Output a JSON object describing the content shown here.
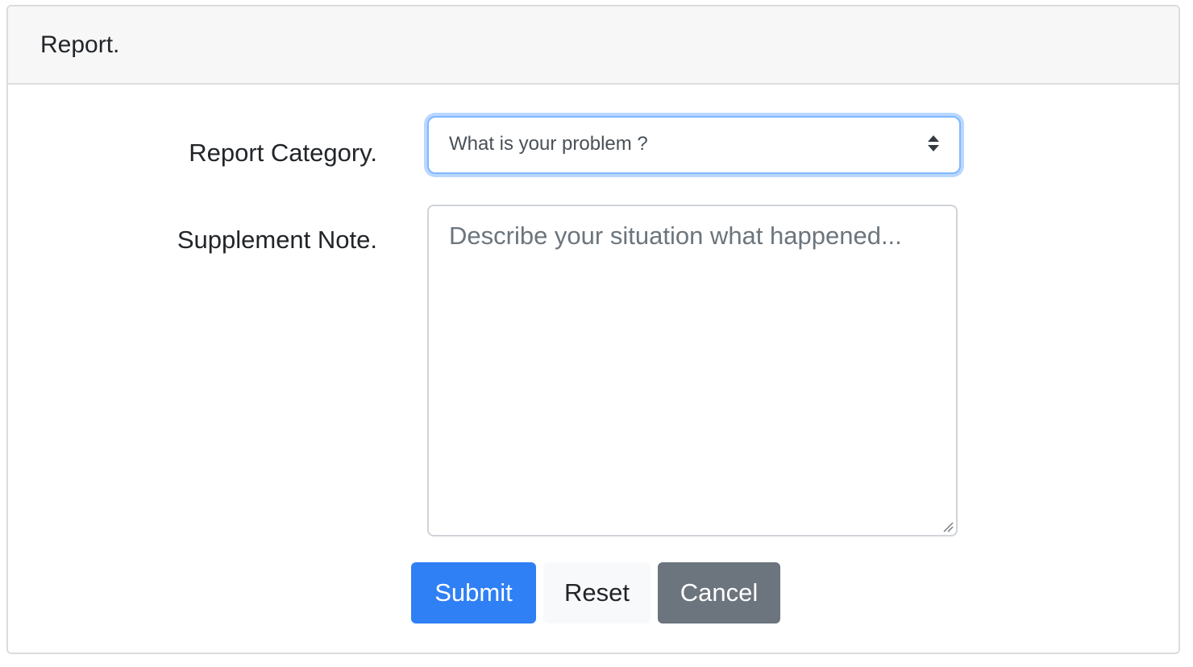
{
  "card": {
    "title": "Report."
  },
  "form": {
    "category_label": "Report Category.",
    "category_select": {
      "selected": "What is your problem ?"
    },
    "note_label": "Supplement Note.",
    "note_textarea": {
      "value": "",
      "placeholder": "Describe your situation what happened..."
    }
  },
  "buttons": {
    "submit": "Submit",
    "reset": "Reset",
    "cancel": "Cancel"
  },
  "colors": {
    "primary": "#2f80f5",
    "secondary": "#6c757d",
    "light": "#f8f9fa",
    "focus_ring": "#80b7ff"
  },
  "icons": {
    "select_arrows": "sort-arrows-icon",
    "resize": "resize-handle-icon"
  }
}
